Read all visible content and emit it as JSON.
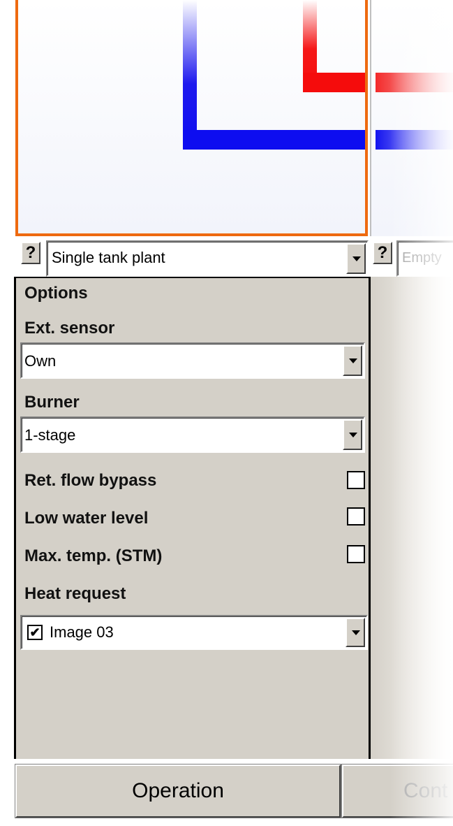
{
  "plant_selector": {
    "help_label": "?",
    "value": "Single tank plant"
  },
  "second_selector": {
    "help_label": "?",
    "placeholder": "Empty"
  },
  "options": {
    "title": "Options",
    "ext_sensor": {
      "label": "Ext. sensor",
      "value": "Own"
    },
    "burner": {
      "label": "Burner",
      "value": "1-stage"
    },
    "ret_flow_bypass": {
      "label": "Ret. flow bypass",
      "checked": false
    },
    "low_water_level": {
      "label": "Low water level",
      "checked": false
    },
    "max_temp": {
      "label": "Max. temp. (STM)",
      "checked": false
    },
    "heat_request": {
      "label": "Heat request",
      "value": "Image 03",
      "checked": true,
      "check_glyph": "✔"
    }
  },
  "tabs": {
    "operation": "Operation",
    "second": "Cont"
  },
  "colors": {
    "selection_border": "#ee6a10",
    "supply_pipe": "#f50c0c",
    "return_pipe": "#0d0df0",
    "panel_bg": "#d4d0c8"
  }
}
